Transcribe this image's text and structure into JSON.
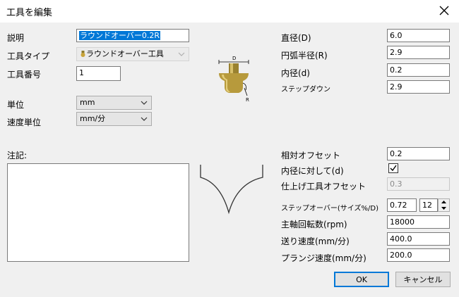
{
  "window": {
    "title": "工具を編集"
  },
  "left": {
    "description_label": "説明",
    "description_value": "ラウンドオーバー0.2R",
    "tool_type_label": "工具タイプ",
    "tool_type_value": "ラウンドオーバー工具",
    "tool_number_label": "工具番号",
    "tool_number_value": "1",
    "unit_label": "単位",
    "unit_value": "mm",
    "speed_unit_label": "速度単位",
    "speed_unit_value": "mm/分",
    "notes_label": "注記:",
    "notes_value": ""
  },
  "diagram": {
    "dimension_d": "D",
    "radius_r": "R"
  },
  "right": {
    "diameter_label": "直径(D)",
    "diameter_value": "6.0",
    "arc_radius_label": "円弧半径(R)",
    "arc_radius_value": "2.9",
    "inner_diameter_label": "内径(d)",
    "inner_diameter_value": "0.2",
    "step_down_label": "ステップダウン",
    "step_down_value": "2.9",
    "relative_offset_label": "相対オフセット",
    "relative_offset_value": "0.2",
    "relative_to_inner_label": "内径に対して(d)",
    "relative_to_inner_checked": true,
    "finish_offset_label": "仕上げ工具オフセット",
    "finish_offset_value": "0.3",
    "stepover_label": "ステップオーバー(サイズ%/D)",
    "stepover_value": "0.72",
    "stepover_percent": "12",
    "spindle_speed_label": "主軸回転数(rpm)",
    "spindle_speed_value": "18000",
    "feed_rate_label": "送り速度(mm/分)",
    "feed_rate_value": "400.0",
    "plunge_rate_label": "プランジ速度(mm/分)",
    "plunge_rate_value": "200.0"
  },
  "buttons": {
    "ok": "OK",
    "cancel": "キャンセル"
  },
  "colors": {
    "accent": "#0078d7",
    "tool_gold": "#b79a3c"
  }
}
